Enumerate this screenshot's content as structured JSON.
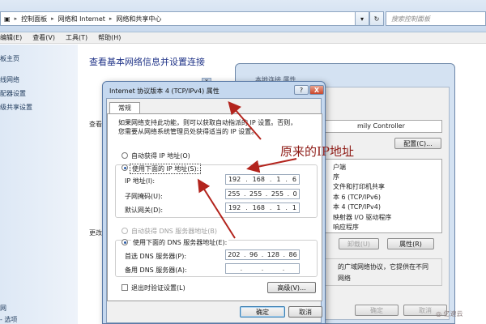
{
  "window": {
    "breadcrumb": [
      "控制面板",
      "网络和 Internet",
      "网络和共享中心"
    ],
    "search_placeholder": "搜索控制面板",
    "menu": [
      "编辑(E)",
      "查看(V)",
      "工具(T)",
      "帮助(H)"
    ],
    "sidebar": [
      "板主页",
      "线网络",
      "配器设置",
      "级共享设置",
      "网",
      "- 选项"
    ],
    "main_title": "查看基本网络信息并设置连接",
    "main_fragments": [
      "查看",
      "更改"
    ]
  },
  "background_dialog": {
    "title_fragment": "本地连接 属性",
    "adapter_fragment": "mily Controller",
    "configure_button": "配置(C)...",
    "items": [
      "户端",
      "序",
      "文件和打印机共享",
      "本 6 (TCP/IPv6)",
      "本 4 (TCP/IPv4)",
      "映射器 I/O 驱动程序",
      "响应程序"
    ],
    "uninstall_button": "卸载(U)",
    "properties_button": "属性(R)",
    "description": [
      "的广域网络协议，它提供在不同",
      "网络"
    ],
    "ok_button": "确定",
    "cancel_button": "取消"
  },
  "dialog": {
    "title": "Internet 协议版本 4 (TCP/IPv4) 属性",
    "help_label": "?",
    "close_label": "X",
    "tab": "常规",
    "intro": [
      "如果网络支持此功能，则可以获取自动指派的 IP 设置。否则，",
      "您需要从网络系统管理员处获得适当的 IP 设置。"
    ],
    "ip": {
      "auto_label": "自动获得 IP 地址(O)",
      "manual_label": "使用下面的 IP 地址(S):",
      "address_label": "IP 地址(I):",
      "address": [
        "192",
        "168",
        "1",
        "6"
      ],
      "mask_label": "子网掩码(U):",
      "mask": [
        "255",
        "255",
        "255",
        "0"
      ],
      "gateway_label": "默认网关(D):",
      "gateway": [
        "192",
        "168",
        "1",
        "1"
      ]
    },
    "dns": {
      "auto_label": "自动获得 DNS 服务器地址(B)",
      "manual_label": "使用下面的 DNS 服务器地址(E):",
      "preferred_label": "首选 DNS 服务器(P):",
      "preferred": [
        "202",
        "96",
        "128",
        "86"
      ],
      "alternate_label": "备用 DNS 服务器(A):",
      "alternate": [
        "",
        "",
        "",
        ""
      ]
    },
    "validate_label": "退出时验证设置(L)",
    "advanced_button": "高级(V)...",
    "ok_button": "确定",
    "cancel_button": "取消"
  },
  "annotation": {
    "text": "原来的IP地址",
    "color": "#8e1b16"
  },
  "watermark": "亿速云"
}
